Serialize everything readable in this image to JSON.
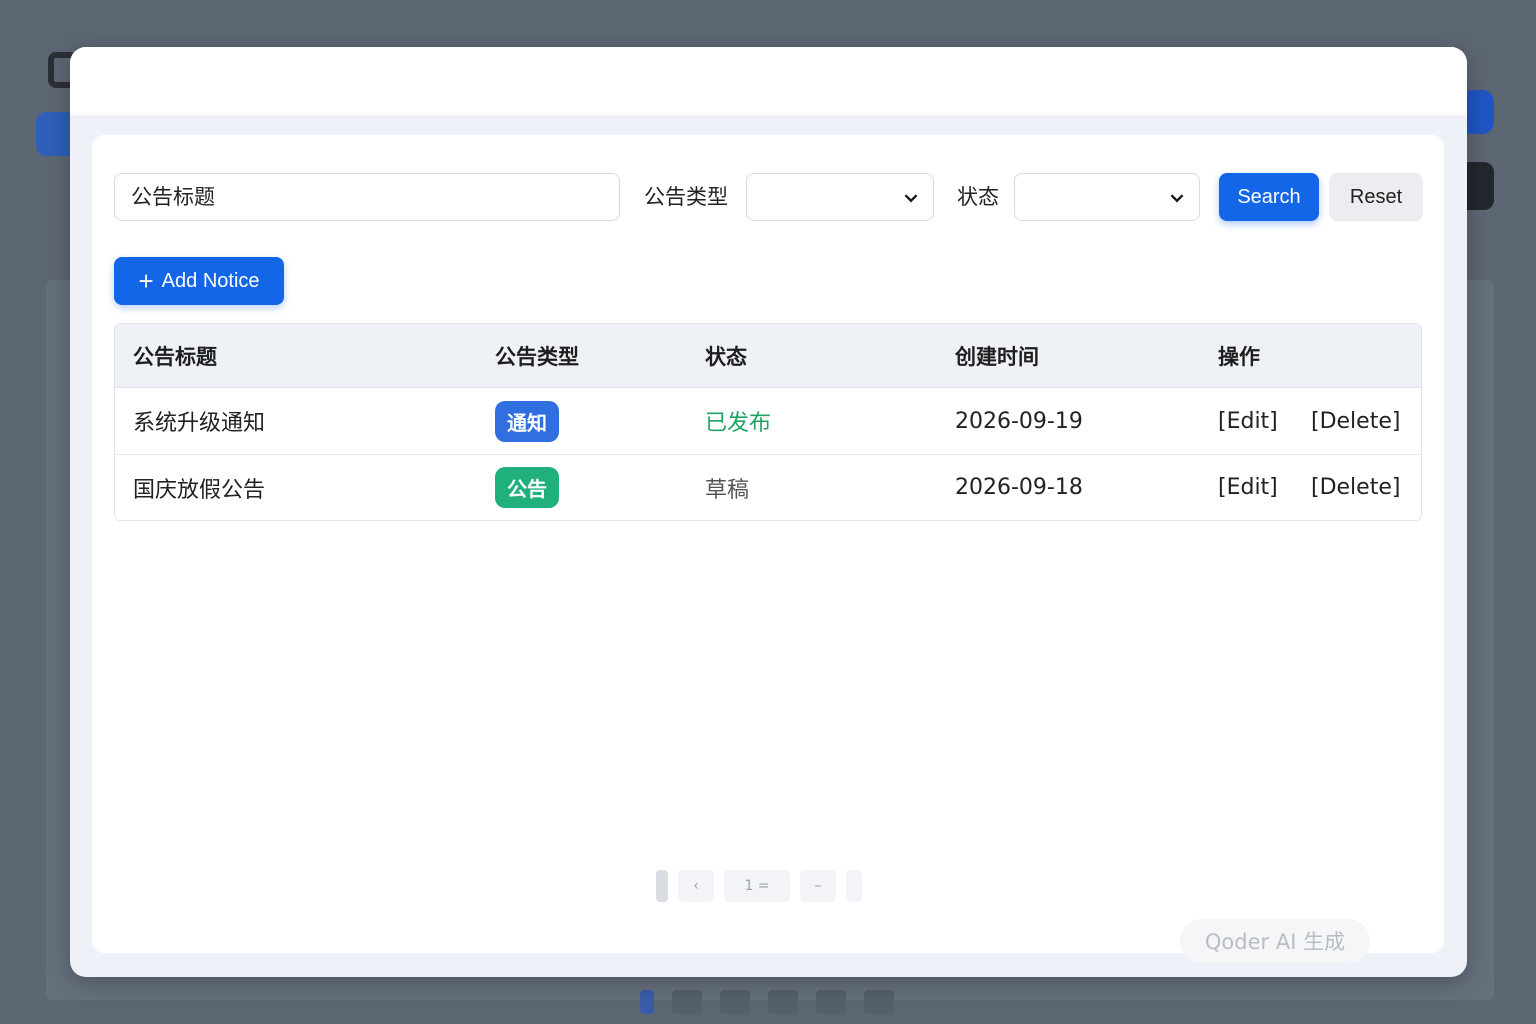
{
  "search": {
    "title_value": "公告标题",
    "type_label": "公告类型",
    "type_value": "",
    "status_label": "状态",
    "status_value": "",
    "search_button": "Search",
    "reset_button": "Reset"
  },
  "toolbar": {
    "add_button": "Add Notice",
    "add_icon": "plus-icon"
  },
  "table": {
    "headers": [
      "公告标题",
      "公告类型",
      "状态",
      "创建时间",
      "操作"
    ],
    "rows": [
      {
        "title": "系统升级通知",
        "type": "通知",
        "status": "已发布",
        "created": "2026-09-19",
        "edit": "[Edit]",
        "delete": "[Delete]"
      },
      {
        "title": "国庆放假公告",
        "type": "公告",
        "status": "草稿",
        "created": "2026-09-18",
        "edit": "[Edit]",
        "delete": "[Delete]"
      }
    ]
  },
  "pagination": {
    "prev_symbol": "‹",
    "mid_symbols": "1 =",
    "next_symbol": "–"
  },
  "watermark": "Qoder AI 生成",
  "colors": {
    "primary": "#1366e8",
    "tag_notice": "#2f6fe0",
    "tag_announcement": "#1fb07c",
    "status_published": "#1fa463",
    "overlay": "#5d6673"
  }
}
